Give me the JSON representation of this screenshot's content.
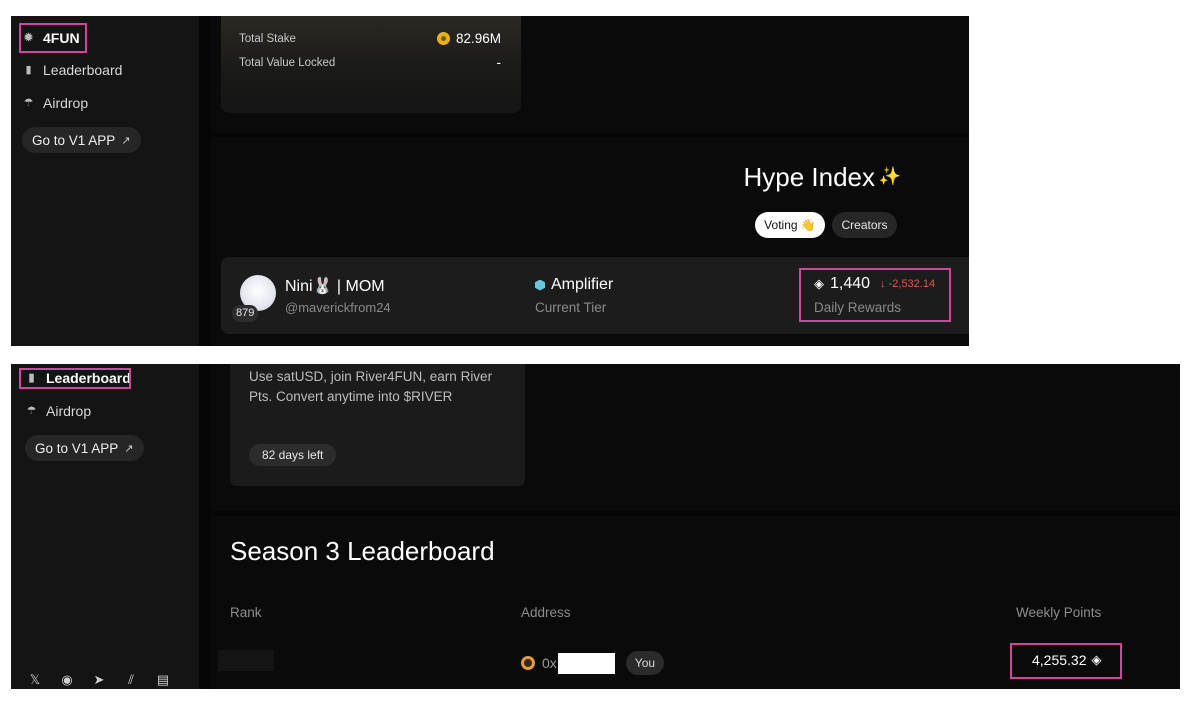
{
  "panel1": {
    "nav": {
      "active_label": "4FUN",
      "leaderboard_label": "Leaderboard",
      "airdrop_label": "Airdrop",
      "v1_label": "Go to V1 APP",
      "v1_arrow": "↗"
    },
    "stake": {
      "total_stake_label": "Total Stake",
      "total_stake_value": "82.96M",
      "tvl_label": "Total Value Locked",
      "tvl_value": "-"
    },
    "hype": {
      "title": "Hype Index",
      "sparkle": "✨",
      "tab_voting": "Voting 👋",
      "tab_creators": "Creators"
    },
    "user": {
      "name": "Nini🐰 | MOM",
      "handle": "@maverickfrom24",
      "rank_badge": "879",
      "tier": "Amplifier",
      "tier_caption": "Current Tier",
      "rewards": "1,440",
      "rewards_change": "↓ -2,532.14",
      "rewards_caption": "Daily Rewards"
    }
  },
  "panel2": {
    "nav": {
      "active_label": "Leaderboard",
      "airdrop_label": "Airdrop",
      "v1_label": "Go to V1 APP",
      "v1_arrow": "↗"
    },
    "info": {
      "text": "Use satUSD, join River4FUN, earn River Pts. Convert anytime into $RIVER",
      "days_left": "82 days left"
    },
    "leaderboard": {
      "title": "Season 3 Leaderboard",
      "columns": {
        "rank": "Rank",
        "address": "Address",
        "points": "Weekly Points"
      },
      "row": {
        "address_prefix": "0x",
        "you_label": "You",
        "points": "4,255.32"
      }
    },
    "social_icons": [
      "x-icon",
      "discord-icon",
      "telegram-icon",
      "mirror-icon",
      "docs-icon"
    ]
  },
  "colors": {
    "highlight": "#d0479a",
    "background": "#0a0a0a",
    "sidebar": "#141414",
    "negative": "#e0584e",
    "tier_gem": "#64c7df",
    "coin": "#e8b21a"
  }
}
